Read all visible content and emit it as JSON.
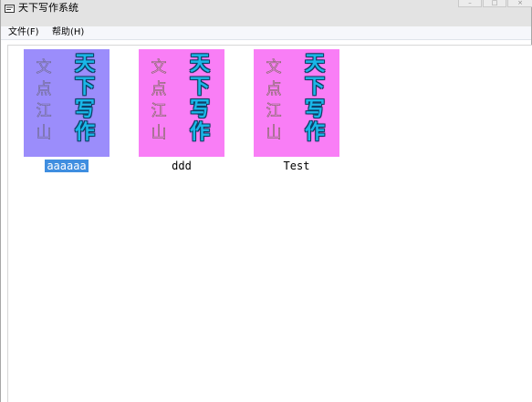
{
  "window": {
    "title": "天下写作系统",
    "controls": {
      "minimize": "–",
      "maximize": "□",
      "close": "×"
    }
  },
  "menu": {
    "file": "文件(F)",
    "help": "帮助(H)"
  },
  "books": [
    {
      "name": "aaaaaa",
      "selected": true,
      "cover_color": "#9b8dfb",
      "cover_title": [
        "天",
        "下",
        "写",
        "作"
      ],
      "cover_subtitle": [
        "文",
        "点",
        "江",
        "山"
      ]
    },
    {
      "name": "ddd",
      "selected": false,
      "cover_color": "#f97ef6",
      "cover_title": [
        "天",
        "下",
        "写",
        "作"
      ],
      "cover_subtitle": [
        "文",
        "点",
        "江",
        "山"
      ]
    },
    {
      "name": "Test",
      "selected": false,
      "cover_color": "#f97ef6",
      "cover_title": [
        "天",
        "下",
        "写",
        "作"
      ],
      "cover_subtitle": [
        "文",
        "点",
        "江",
        "山"
      ]
    }
  ],
  "colors": {
    "title_text": "#1ab7e8",
    "selection": "#3f8ee0"
  }
}
